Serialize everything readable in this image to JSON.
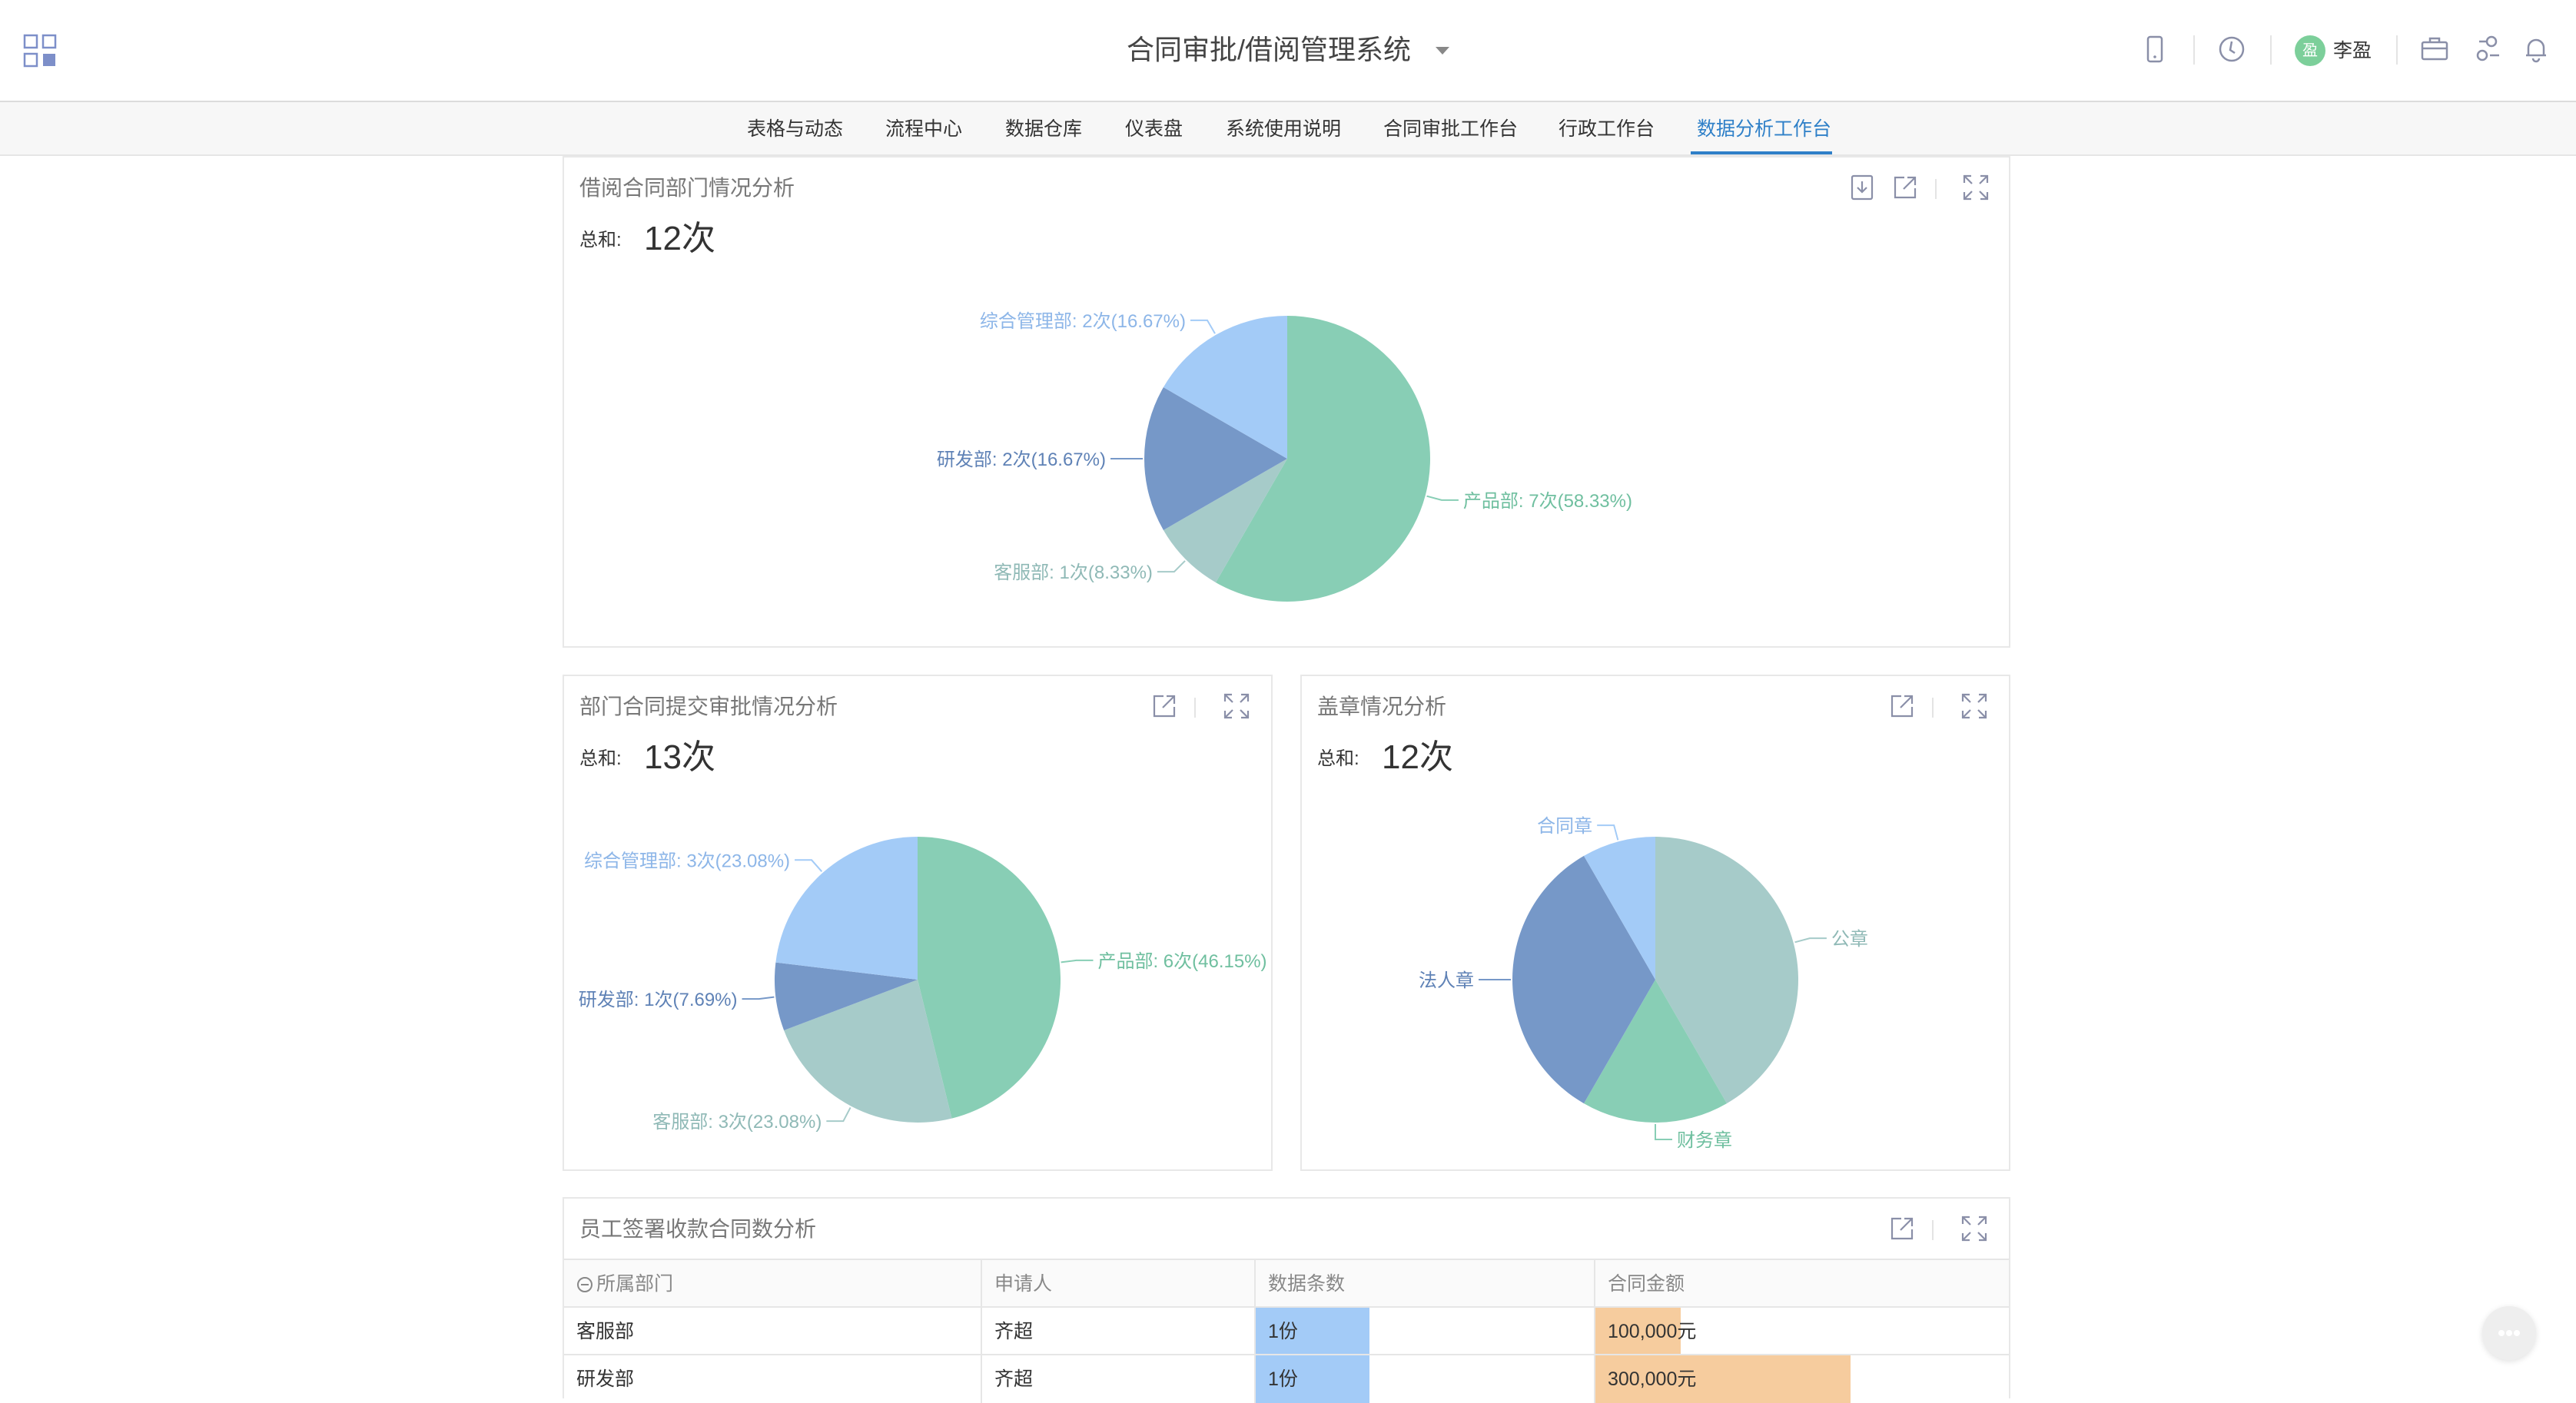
{
  "header": {
    "title": "合同审批/借阅管理系统",
    "user_name": "李盈",
    "user_initial": "盈",
    "icons": [
      "apps-icon",
      "mobile-icon",
      "clock-icon",
      "avatar",
      "briefcase-icon",
      "connect-icon",
      "bell-icon"
    ]
  },
  "nav": {
    "tabs": [
      {
        "label": "表格与动态"
      },
      {
        "label": "流程中心"
      },
      {
        "label": "数据仓库"
      },
      {
        "label": "仪表盘"
      },
      {
        "label": "系统使用说明"
      },
      {
        "label": "合同审批工作台"
      },
      {
        "label": "行政工作台"
      },
      {
        "label": "数据分析工作台"
      }
    ],
    "active_index": 7
  },
  "cards": {
    "borrow": {
      "title": "借阅合同部门情况分析",
      "sum_label": "总和:",
      "sum_value": "12次"
    },
    "submit": {
      "title": "部门合同提交审批情况分析",
      "sum_label": "总和:",
      "sum_value": "13次"
    },
    "seal": {
      "title": "盖章情况分析",
      "sum_label": "总和:",
      "sum_value": "12次"
    },
    "contracts": {
      "title": "员工签署收款合同数分析"
    }
  },
  "chart_data": [
    {
      "type": "pie",
      "title": "借阅合同部门情况分析",
      "slices": [
        {
          "label": "产品部",
          "value": 7,
          "text": "产品部: 7次(58.33%)",
          "color": "#88ceb5"
        },
        {
          "label": "客服部",
          "value": 1,
          "text": "客服部: 1次(8.33%)",
          "color": "#a6cbc9"
        },
        {
          "label": "研发部",
          "value": 2,
          "text": "研发部: 2次(16.67%)",
          "color": "#7698c8"
        },
        {
          "label": "综合管理部",
          "value": 2,
          "text": "综合管理部: 2次(16.67%)",
          "color": "#a3cbf7"
        }
      ]
    },
    {
      "type": "pie",
      "title": "部门合同提交审批情况分析",
      "slices": [
        {
          "label": "产品部",
          "value": 6,
          "text": "产品部: 6次(46.15%)",
          "color": "#88ceb5"
        },
        {
          "label": "客服部",
          "value": 3,
          "text": "客服部: 3次(23.08%)",
          "color": "#a6cbc9"
        },
        {
          "label": "研发部",
          "value": 1,
          "text": "研发部: 1次(7.69%)",
          "color": "#7698c8"
        },
        {
          "label": "综合管理部",
          "value": 3,
          "text": "综合管理部: 3次(23.08%)",
          "color": "#a3cbf7"
        }
      ]
    },
    {
      "type": "pie",
      "title": "盖章情况分析",
      "slices": [
        {
          "label": "公章",
          "value": 5,
          "text": "公章",
          "color": "#a6cbc9"
        },
        {
          "label": "财务章",
          "value": 2,
          "text": "财务章",
          "color": "#88ceb5"
        },
        {
          "label": "法人章",
          "value": 4,
          "text": "法人章",
          "color": "#7698c8"
        },
        {
          "label": "合同章",
          "value": 1,
          "text": "合同章",
          "color": "#a3cbf7"
        }
      ]
    }
  ],
  "table": {
    "columns": [
      "所属部门",
      "申请人",
      "数据条数",
      "合同金额"
    ],
    "rows": [
      {
        "dept": "客服部",
        "applicant": "齐超",
        "count": "1份",
        "count_value": 1,
        "amount": "100,000元",
        "amount_value": 100000
      },
      {
        "dept": "研发部",
        "applicant": "齐超",
        "count": "1份",
        "count_value": 1,
        "amount": "300,000元",
        "amount_value": 300000
      }
    ],
    "count_bar_color": "#a3cbf7",
    "amount_bar_color": "#f6cc9e"
  }
}
